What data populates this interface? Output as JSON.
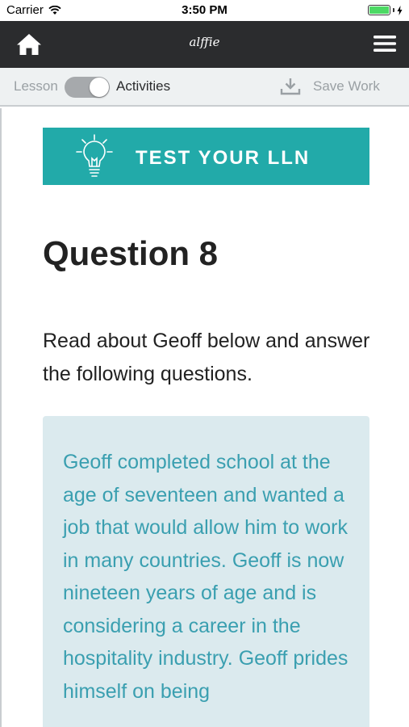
{
  "status_bar": {
    "carrier": "Carrier",
    "time": "3:50 PM",
    "battery_level": 1.0
  },
  "navbar": {
    "title": "alffie",
    "home_icon": "home-icon",
    "menu_icon": "hamburger-menu-icon",
    "background": "#2b2c2e"
  },
  "toolbar": {
    "lesson_label": "Lesson",
    "activities_label": "Activities",
    "toggle_on": true,
    "save_label": "Save Work",
    "save_icon": "download-icon"
  },
  "banner": {
    "text": "TEST YOUR LLN",
    "icon": "lightbulb-icon",
    "color": "#22aaa9"
  },
  "question": {
    "title": "Question 8",
    "intro": "Read about Geoff below and answer the following questions."
  },
  "passage": {
    "text": "Geoff completed school at the age of seventeen and wanted a job that would allow him to work in many countries. Geoff is now nineteen years of age and is considering a career in the hospitality industry. Geoff prides himself on being",
    "text_color": "#3a9fb0",
    "background": "#dbeaee"
  }
}
